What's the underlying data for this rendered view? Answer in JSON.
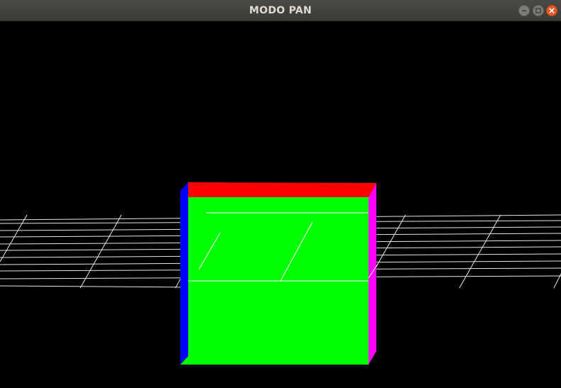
{
  "window": {
    "title": "MODO PAN",
    "controls": {
      "minimize_icon": "minimize-icon",
      "maximize_icon": "maximize-icon",
      "close_icon": "close-icon"
    }
  },
  "scene": {
    "background_color": "#000000",
    "grid_color": "#ffffff",
    "cube_faces": {
      "front": "#00ff00",
      "top": "#ff0000",
      "left": "#0000ff",
      "right": "#ff00ff"
    }
  }
}
